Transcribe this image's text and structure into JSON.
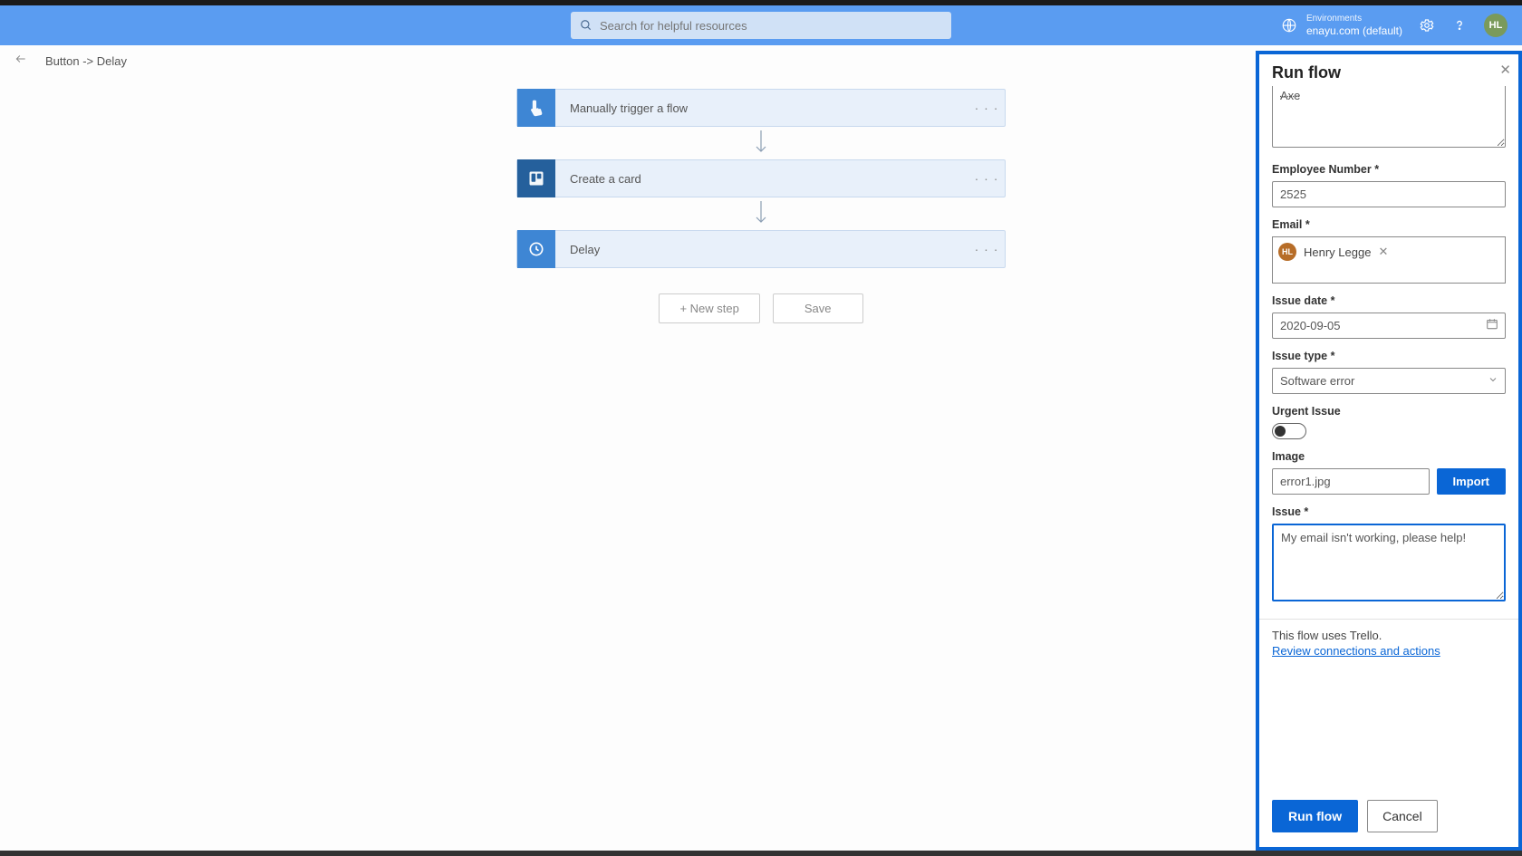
{
  "header": {
    "search_placeholder": "Search for helpful resources",
    "env_label": "Environments",
    "env_name": "enayu.com (default)",
    "badge": "HL"
  },
  "breadcrumb": "Button -> Delay",
  "flow": {
    "steps": [
      {
        "label": "Manually trigger a flow",
        "icon": "touch"
      },
      {
        "label": "Create a card",
        "icon": "trello"
      },
      {
        "label": "Delay",
        "icon": "clock"
      }
    ],
    "new_step": "+ New step",
    "save": "Save"
  },
  "panel": {
    "title": "Run flow",
    "prev_field_value": "Axe",
    "emp_no_label": "Employee Number *",
    "emp_no_value": "2525",
    "email_label": "Email *",
    "email_person": "Henry Legge",
    "email_avatar": "HL",
    "issue_date_label": "Issue date *",
    "issue_date_value": "2020-09-05",
    "issue_type_label": "Issue type *",
    "issue_type_value": "Software error",
    "urgent_label": "Urgent Issue",
    "image_label": "Image",
    "image_value": "error1.jpg",
    "import": "Import",
    "issue_label": "Issue *",
    "issue_value": "My email isn't working, please help!",
    "uses_text": "This flow uses Trello.",
    "review_link": "Review connections and actions",
    "run": "Run flow",
    "cancel": "Cancel"
  }
}
